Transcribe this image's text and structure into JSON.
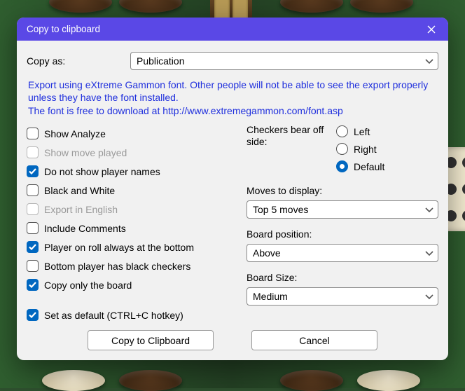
{
  "dialog": {
    "title": "Copy to clipboard"
  },
  "copy_as": {
    "label": "Copy as:",
    "value": "Publication"
  },
  "info": {
    "line1": "Export using eXtreme Gammon font. Other people will not be able to see the export properly unless they have the font installed.",
    "line2_prefix": "The font is free to download at ",
    "line2_link": "http://www.extremegammon.com/font.asp"
  },
  "checks": {
    "show_analyze": {
      "label": "Show Analyze",
      "checked": false,
      "disabled": false
    },
    "show_move_played": {
      "label": "Show move played",
      "checked": false,
      "disabled": true
    },
    "hide_names": {
      "label": "Do not show player names",
      "checked": true,
      "disabled": false
    },
    "bw": {
      "label": "Black and White",
      "checked": false,
      "disabled": false
    },
    "export_english": {
      "label": "Export in English",
      "checked": false,
      "disabled": true
    },
    "include_comments": {
      "label": "Include Comments",
      "checked": false,
      "disabled": false
    },
    "player_bottom": {
      "label": "Player on roll always at the bottom",
      "checked": true,
      "disabled": false
    },
    "bottom_black": {
      "label": "Bottom player has black checkers",
      "checked": false,
      "disabled": false
    },
    "copy_board": {
      "label": "Copy only the board",
      "checked": true,
      "disabled": false
    },
    "set_default": {
      "label": "Set as default (CTRL+C hotkey)",
      "checked": true,
      "disabled": false
    }
  },
  "bearoff": {
    "label": "Checkers bear off side:",
    "options": {
      "left": "Left",
      "right": "Right",
      "def": "Default"
    },
    "selected": "def"
  },
  "moves": {
    "label": "Moves to display:",
    "value": "Top 5 moves"
  },
  "boardpos": {
    "label": "Board position:",
    "value": "Above"
  },
  "boardsize": {
    "label": "Board Size:",
    "value": "Medium"
  },
  "buttons": {
    "copy": "Copy to Clipboard",
    "cancel": "Cancel"
  }
}
